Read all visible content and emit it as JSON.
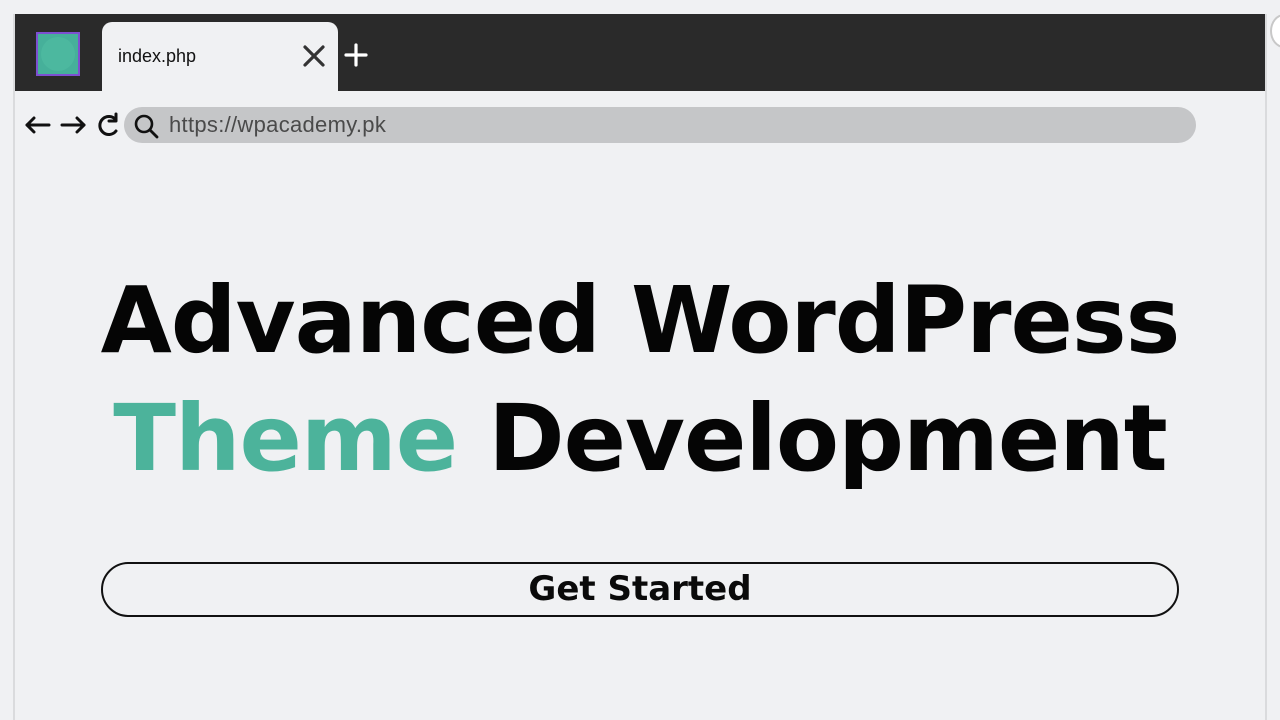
{
  "browser": {
    "tab": {
      "title": "index.php",
      "close_icon": "close-icon"
    },
    "new_tab_icon": "plus-icon",
    "app_icon": "site-logo-icon",
    "nav": {
      "back_icon": "arrow-left-icon",
      "forward_icon": "arrow-right-icon",
      "reload_icon": "reload-icon"
    },
    "address": {
      "search_icon": "search-icon",
      "url": "https://wpacademy.pk"
    }
  },
  "hero": {
    "line1": "Advanced WordPress",
    "line2_accent": "Theme",
    "line2_rest": "Development"
  },
  "cta": {
    "label": "Get Started"
  },
  "colors": {
    "accent": "#4cb39b",
    "tab_strip": "#2a2a2a",
    "page_bg": "#f0f1f3",
    "address_bar": "#c5c6c8",
    "text": "#050505"
  }
}
